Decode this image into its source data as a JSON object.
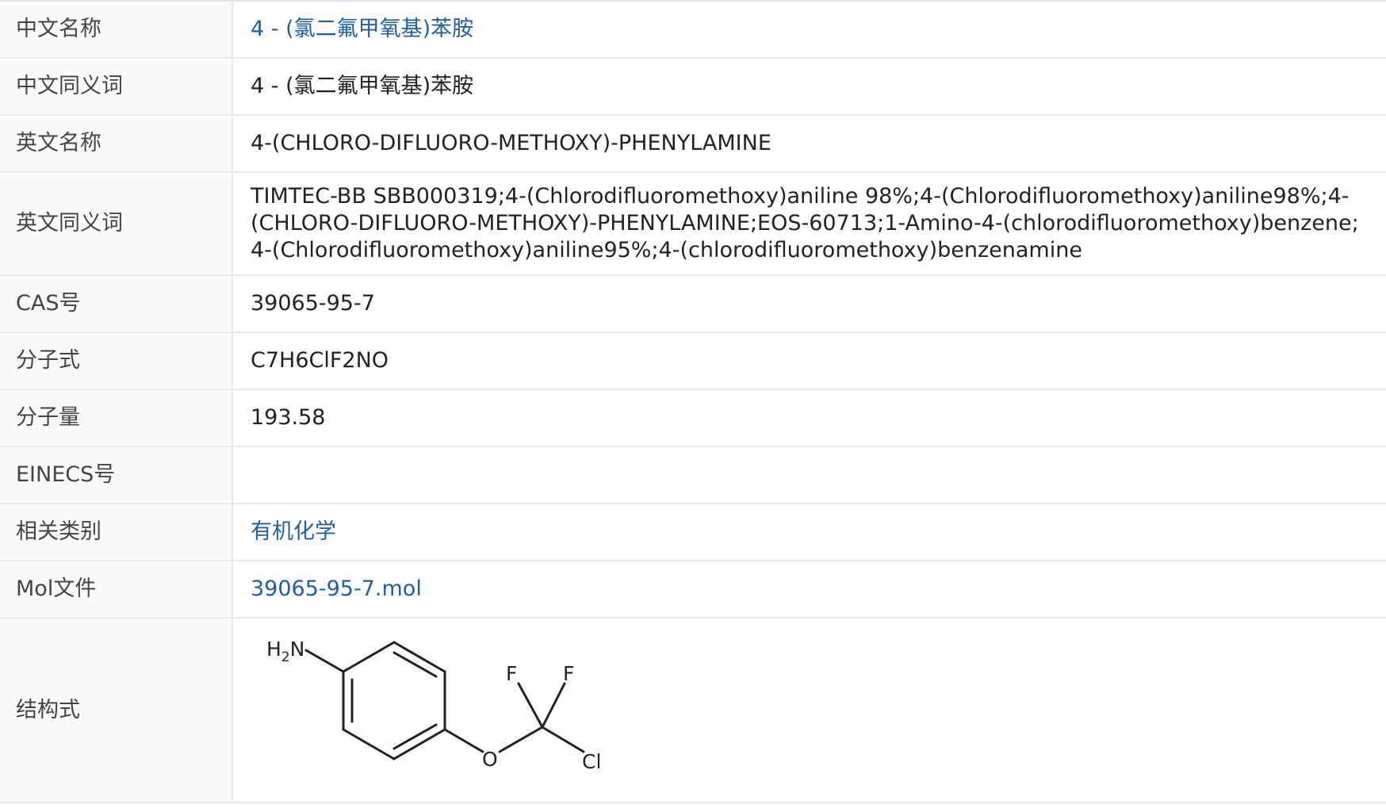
{
  "rows": [
    {
      "label": "中文名称",
      "value": "4 - (氯二氟甲氧基)苯胺",
      "link": true
    },
    {
      "label": "中文同义词",
      "value": "4 - (氯二氟甲氧基)苯胺",
      "link": false
    },
    {
      "label": "英文名称",
      "value": "4-(CHLORO-DIFLUORO-METHOXY)-PHENYLAMINE",
      "link": false
    },
    {
      "label": "英文同义词",
      "value": "TIMTEC-BB SBB000319;4-(Chlorodifluoromethoxy)aniline 98%;4-(Chlorodifluoromethoxy)aniline98%;4-(CHLORO-DIFLUORO-METHOXY)-PHENYLAMINE;EOS-60713;1-Amino-4-(chlorodifluoromethoxy)benzene;4-(Chlorodifluoromethoxy)aniline95%;4-(chlorodifluoromethoxy)benzenamine",
      "link": false
    },
    {
      "label": "CAS号",
      "value": "39065-95-7",
      "link": false
    },
    {
      "label": "分子式",
      "value": "C7H6ClF2NO",
      "link": false
    },
    {
      "label": "分子量",
      "value": "193.58",
      "link": false
    },
    {
      "label": "EINECS号",
      "value": "",
      "link": false
    },
    {
      "label": "相关类别",
      "value": "有机化学",
      "link": true
    },
    {
      "label": "Mol文件",
      "value": "39065-95-7.mol",
      "link": true
    },
    {
      "label": "结构式",
      "value": "",
      "link": false
    }
  ],
  "structure": {
    "atom_h2n_h": "H",
    "atom_h2n_sub": "2",
    "atom_h2n_n": "N",
    "atom_o": "O",
    "atom_f1": "F",
    "atom_f2": "F",
    "atom_cl": "Cl"
  },
  "colors": {
    "link": "#1f5fa8",
    "label_bg": "#fafafa",
    "border": "#e8e8e8"
  }
}
